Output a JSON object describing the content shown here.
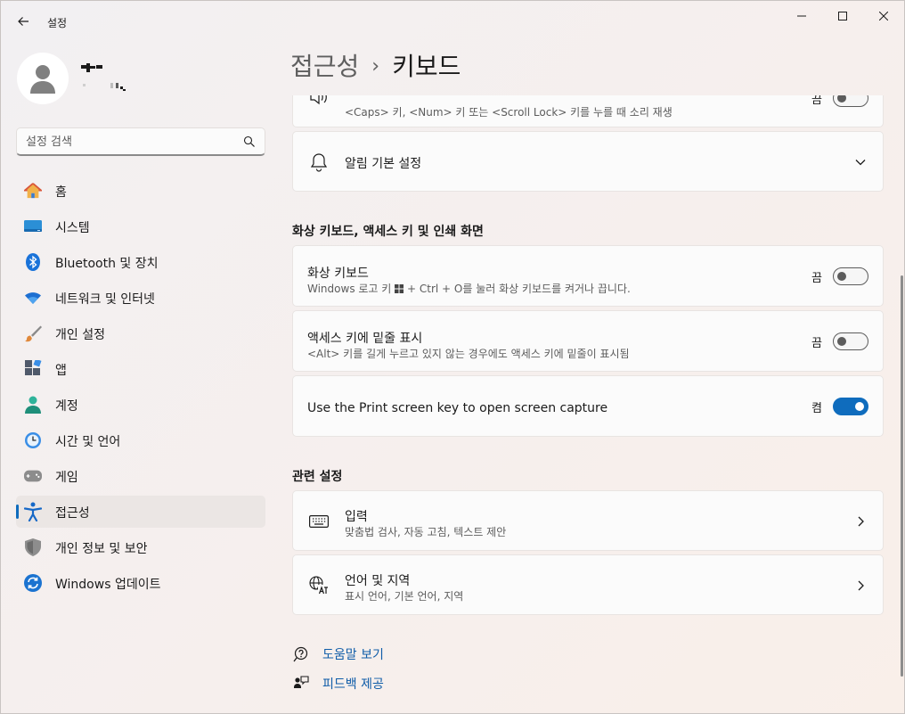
{
  "window": {
    "title": "설정",
    "controls": {
      "minimize": "minimize-icon",
      "maximize": "maximize-icon",
      "close": "close-icon"
    }
  },
  "profile": {
    "avatar": "person-icon"
  },
  "search": {
    "placeholder": "설정 검색"
  },
  "sidebar": {
    "items": [
      {
        "label": "홈",
        "icon": "home-icon"
      },
      {
        "label": "시스템",
        "icon": "system-icon"
      },
      {
        "label": "Bluetooth 및 장치",
        "icon": "bluetooth-icon"
      },
      {
        "label": "네트워크 및 인터넷",
        "icon": "wifi-icon"
      },
      {
        "label": "개인 설정",
        "icon": "brush-icon"
      },
      {
        "label": "앱",
        "icon": "apps-icon"
      },
      {
        "label": "계정",
        "icon": "account-icon"
      },
      {
        "label": "시간 및 언어",
        "icon": "time-language-icon"
      },
      {
        "label": "게임",
        "icon": "gamepad-icon"
      },
      {
        "label": "접근성",
        "icon": "accessibility-icon",
        "selected": true
      },
      {
        "label": "개인 정보 및 보안",
        "icon": "shield-icon"
      },
      {
        "label": "Windows 업데이트",
        "icon": "update-icon"
      }
    ]
  },
  "breadcrumb": {
    "parent": "접근성",
    "separator": "›",
    "current": "키보드"
  },
  "main": {
    "top_card": {
      "desc": "<Caps> 키, <Num> 키 또는 <Scroll Lock> 키를 누를 때 소리 재생",
      "state": "끔",
      "checked": false
    },
    "notification_card": {
      "title": "알림 기본 설정",
      "icon": "bell-icon"
    },
    "section1_heading": "화상 키보드, 액세스 키 및 인쇄 화면",
    "onscreen_keyboard": {
      "title": "화상 키보드",
      "desc_before": "Windows 로고 키",
      "desc_after": "+ Ctrl + O를 눌러 화상 키보드를 켜거나 끕니다.",
      "state": "끔",
      "checked": false
    },
    "access_keys": {
      "title": "액세스 키에 밑줄 표시",
      "desc": "<Alt> 키를 길게 누르고 있지 않는 경우에도 액세스 키에 밑줄이 표시됨",
      "state": "끔",
      "checked": false
    },
    "print_screen": {
      "title": "Use the Print screen key to open screen capture",
      "state": "켬",
      "checked": true
    },
    "related_heading": "관련 설정",
    "typing": {
      "title": "입력",
      "desc": "맞춤법 검사, 자동 고침, 텍스트 제안",
      "icon": "keyboard-icon"
    },
    "language": {
      "title": "언어 및 지역",
      "desc": "표시 언어, 기본 언어, 지역",
      "icon": "language-icon"
    },
    "help_link": "도움말 보기",
    "feedback_link": "피드백 제공"
  },
  "colors": {
    "accent": "#0f6cbd",
    "link": "#0f5ca8"
  }
}
